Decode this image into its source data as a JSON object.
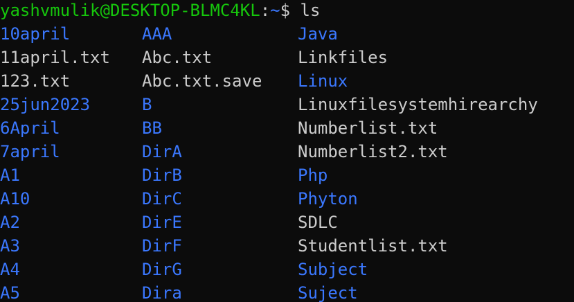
{
  "prompt": {
    "user_host": "yashvmulik@DESKTOP-BLMC4KL",
    "separator": ":",
    "path": "~",
    "symbol": "$",
    "command": " ls"
  },
  "colors": {
    "background": "#0c0c0c",
    "directory": "#3b78ff",
    "file": "#cccccc",
    "prompt_user": "#16c60c"
  },
  "columns": [
    [
      {
        "name": "10april",
        "type": "dir"
      },
      {
        "name": "11april.txt",
        "type": "file"
      },
      {
        "name": "123.txt",
        "type": "file"
      },
      {
        "name": "25jun2023",
        "type": "dir"
      },
      {
        "name": "6April",
        "type": "dir"
      },
      {
        "name": "7april",
        "type": "dir"
      },
      {
        "name": "A1",
        "type": "dir"
      },
      {
        "name": "A10",
        "type": "dir"
      },
      {
        "name": "A2",
        "type": "dir"
      },
      {
        "name": "A3",
        "type": "dir"
      },
      {
        "name": "A4",
        "type": "dir"
      },
      {
        "name": "A5",
        "type": "dir"
      }
    ],
    [
      {
        "name": "AAA",
        "type": "dir"
      },
      {
        "name": "Abc.txt",
        "type": "file"
      },
      {
        "name": "Abc.txt.save",
        "type": "file"
      },
      {
        "name": "B",
        "type": "dir"
      },
      {
        "name": "BB",
        "type": "dir"
      },
      {
        "name": "DirA",
        "type": "dir"
      },
      {
        "name": "DirB",
        "type": "dir"
      },
      {
        "name": "DirC",
        "type": "dir"
      },
      {
        "name": "DirE",
        "type": "dir"
      },
      {
        "name": "DirF",
        "type": "dir"
      },
      {
        "name": "DirG",
        "type": "dir"
      },
      {
        "name": "Dira",
        "type": "dir"
      }
    ],
    [
      {
        "name": "Java",
        "type": "dir"
      },
      {
        "name": "Linkfiles",
        "type": "file"
      },
      {
        "name": "Linux",
        "type": "dir"
      },
      {
        "name": "Linuxfilesystemhirearchy",
        "type": "file"
      },
      {
        "name": "Numberlist.txt",
        "type": "file"
      },
      {
        "name": "Numberlist2.txt",
        "type": "file"
      },
      {
        "name": "Php",
        "type": "dir"
      },
      {
        "name": "Phyton",
        "type": "dir"
      },
      {
        "name": "SDLC",
        "type": "file"
      },
      {
        "name": "Studentlist.txt",
        "type": "file"
      },
      {
        "name": "Subject",
        "type": "dir"
      },
      {
        "name": "Suject",
        "type": "dir"
      }
    ]
  ]
}
